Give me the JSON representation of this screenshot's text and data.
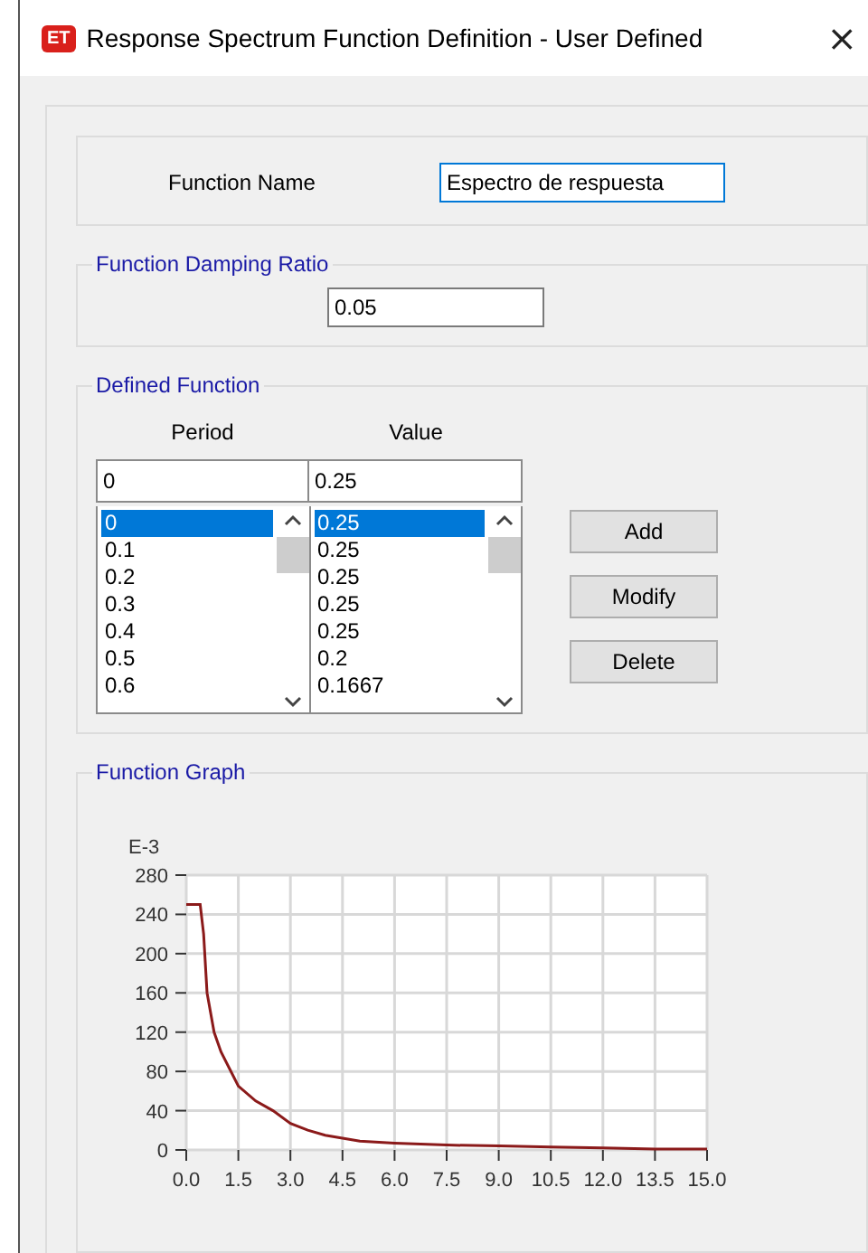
{
  "window": {
    "title": "Response Spectrum Function Definition - User Defined",
    "close": "×",
    "app_badge": "ET"
  },
  "function_name": {
    "label": "Function Name",
    "value": "Espectro de respuesta"
  },
  "damping": {
    "title": "Function Damping Ratio",
    "value": "0.05"
  },
  "defined_function": {
    "title": "Defined Function",
    "columns": [
      "Period",
      "Value"
    ],
    "period_input": "0",
    "value_input": "0.25",
    "periods": [
      {
        "text": "0",
        "selected": true
      },
      {
        "text": "0.1",
        "selected": false
      },
      {
        "text": "0.2",
        "selected": false
      },
      {
        "text": "0.3",
        "selected": false
      },
      {
        "text": "0.4",
        "selected": false
      },
      {
        "text": "0.5",
        "selected": false
      },
      {
        "text": "0.6",
        "selected": false
      }
    ],
    "values": [
      {
        "text": "0.25",
        "selected": true
      },
      {
        "text": "0.25",
        "selected": false
      },
      {
        "text": "0.25",
        "selected": false
      },
      {
        "text": "0.25",
        "selected": false
      },
      {
        "text": "0.25",
        "selected": false
      },
      {
        "text": "0.2",
        "selected": false
      },
      {
        "text": "0.1667",
        "selected": false
      }
    ],
    "buttons": [
      "Add",
      "Modify",
      "Delete"
    ]
  },
  "graph": {
    "title": "Function Graph",
    "chart_data": {
      "type": "line",
      "grid": true,
      "ylabel": "E-3",
      "xlim": [
        0,
        15
      ],
      "ylim": [
        0,
        280
      ],
      "xticks": [
        {
          "value": 0,
          "label": "0.0"
        },
        {
          "value": 1.5,
          "label": "1.5"
        },
        {
          "value": 3,
          "label": "3.0"
        },
        {
          "value": 4.5,
          "label": "4.5"
        },
        {
          "value": 6,
          "label": "6.0"
        },
        {
          "value": 7.5,
          "label": "7.5"
        },
        {
          "value": 9,
          "label": "9.0"
        },
        {
          "value": 10.5,
          "label": "10.5"
        },
        {
          "value": 12,
          "label": "12.0"
        },
        {
          "value": 13.5,
          "label": "13.5"
        },
        {
          "value": 15,
          "label": "15.0"
        }
      ],
      "yticks": [
        0,
        40,
        80,
        120,
        160,
        200,
        240,
        280
      ],
      "x": [
        0,
        0.4,
        0.5,
        0.6,
        0.8,
        1.0,
        1.5,
        2.0,
        2.5,
        3.0,
        3.5,
        4.0,
        4.5,
        5.0,
        6.0,
        7.5,
        9.0,
        10.5,
        12.0,
        13.5,
        15.0
      ],
      "series": [
        {
          "color": "#8b1a1a",
          "values": [
            250,
            250,
            220,
            160,
            120,
            100,
            65,
            50,
            40,
            27,
            20,
            15,
            12,
            9,
            7,
            5,
            4,
            3,
            2,
            1,
            1
          ]
        }
      ]
    }
  }
}
